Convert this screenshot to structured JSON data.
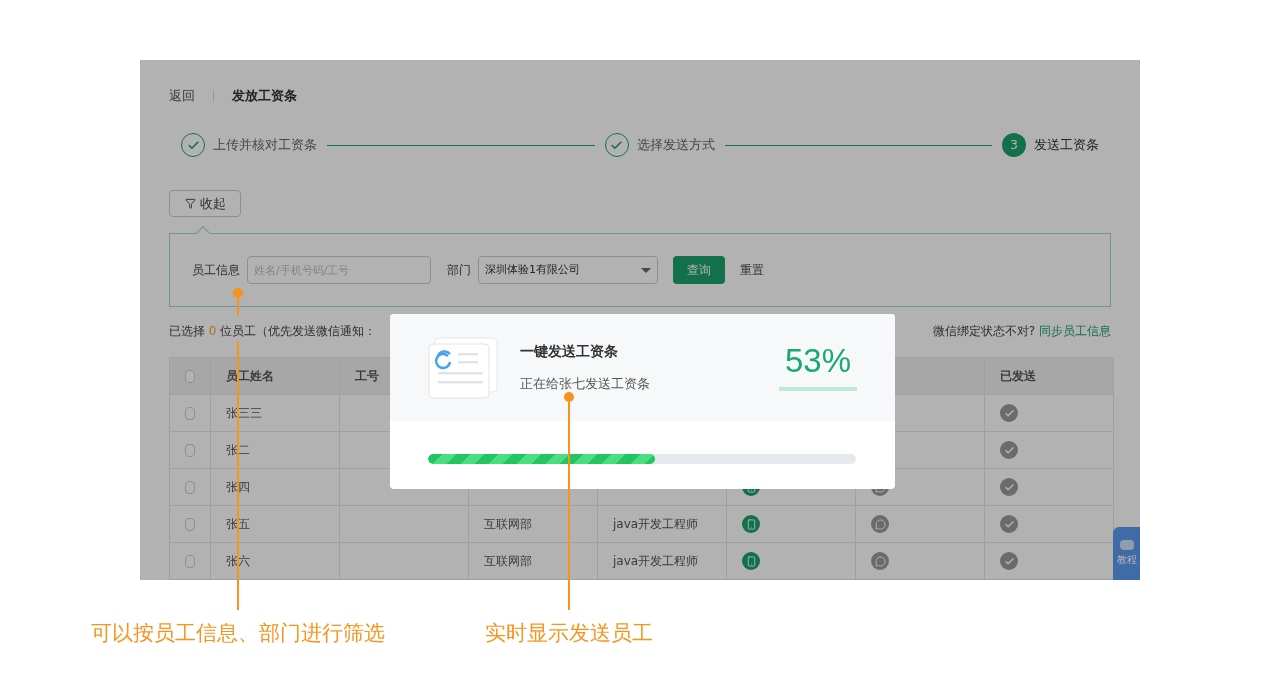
{
  "header": {
    "back": "返回",
    "title": "发放工资条"
  },
  "steps": [
    {
      "label": "上传并核对工资条",
      "kind": "done"
    },
    {
      "label": "选择发送方式",
      "kind": "done"
    },
    {
      "number": "3",
      "label": "发送工资条",
      "kind": "current"
    }
  ],
  "filter_toggle": {
    "label": "收起",
    "expanded": true
  },
  "filter": {
    "employee_label": "员工信息",
    "employee_placeholder": "姓名/手机号码/工号",
    "department_label": "部门",
    "department_value": "深圳体验1有限公司",
    "query_button": "查询",
    "reset_button": "重置"
  },
  "selection": {
    "prefix": "已选择",
    "count": "0",
    "suffix": "位员工（优先发送微信通知："
  },
  "sync": {
    "question": "微信绑定状态不对?",
    "link": "同步员工信息"
  },
  "table": {
    "columns": [
      "员工姓名",
      "工号"
    ],
    "last_column": "已发送",
    "all_checked": false,
    "rows": [
      {
        "name": "张三三",
        "checked": false,
        "sent": true
      },
      {
        "name": "张二",
        "checked": false,
        "sent": true
      },
      {
        "name": "张四",
        "checked": false,
        "phone_bound": true,
        "wechat_bound": false,
        "sent": true
      },
      {
        "name": "张五",
        "checked": false,
        "department": "互联网部",
        "position": "java开发工程师",
        "phone_bound": true,
        "wechat_bound": false,
        "sent": true
      },
      {
        "name": "张六",
        "checked": false,
        "department": "互联网部",
        "position": "java开发工程师",
        "phone_bound": true,
        "wechat_bound": false,
        "sent": true
      }
    ]
  },
  "modal": {
    "title": "一键发送工资条",
    "status": "正在给张七发送工资条",
    "percent": "53%",
    "level": 0.53
  },
  "tutorial_tab": "教程",
  "annotations": [
    {
      "text": "可以按员工信息、部门进行筛选"
    },
    {
      "text": "实时显示发送员工"
    }
  ]
}
